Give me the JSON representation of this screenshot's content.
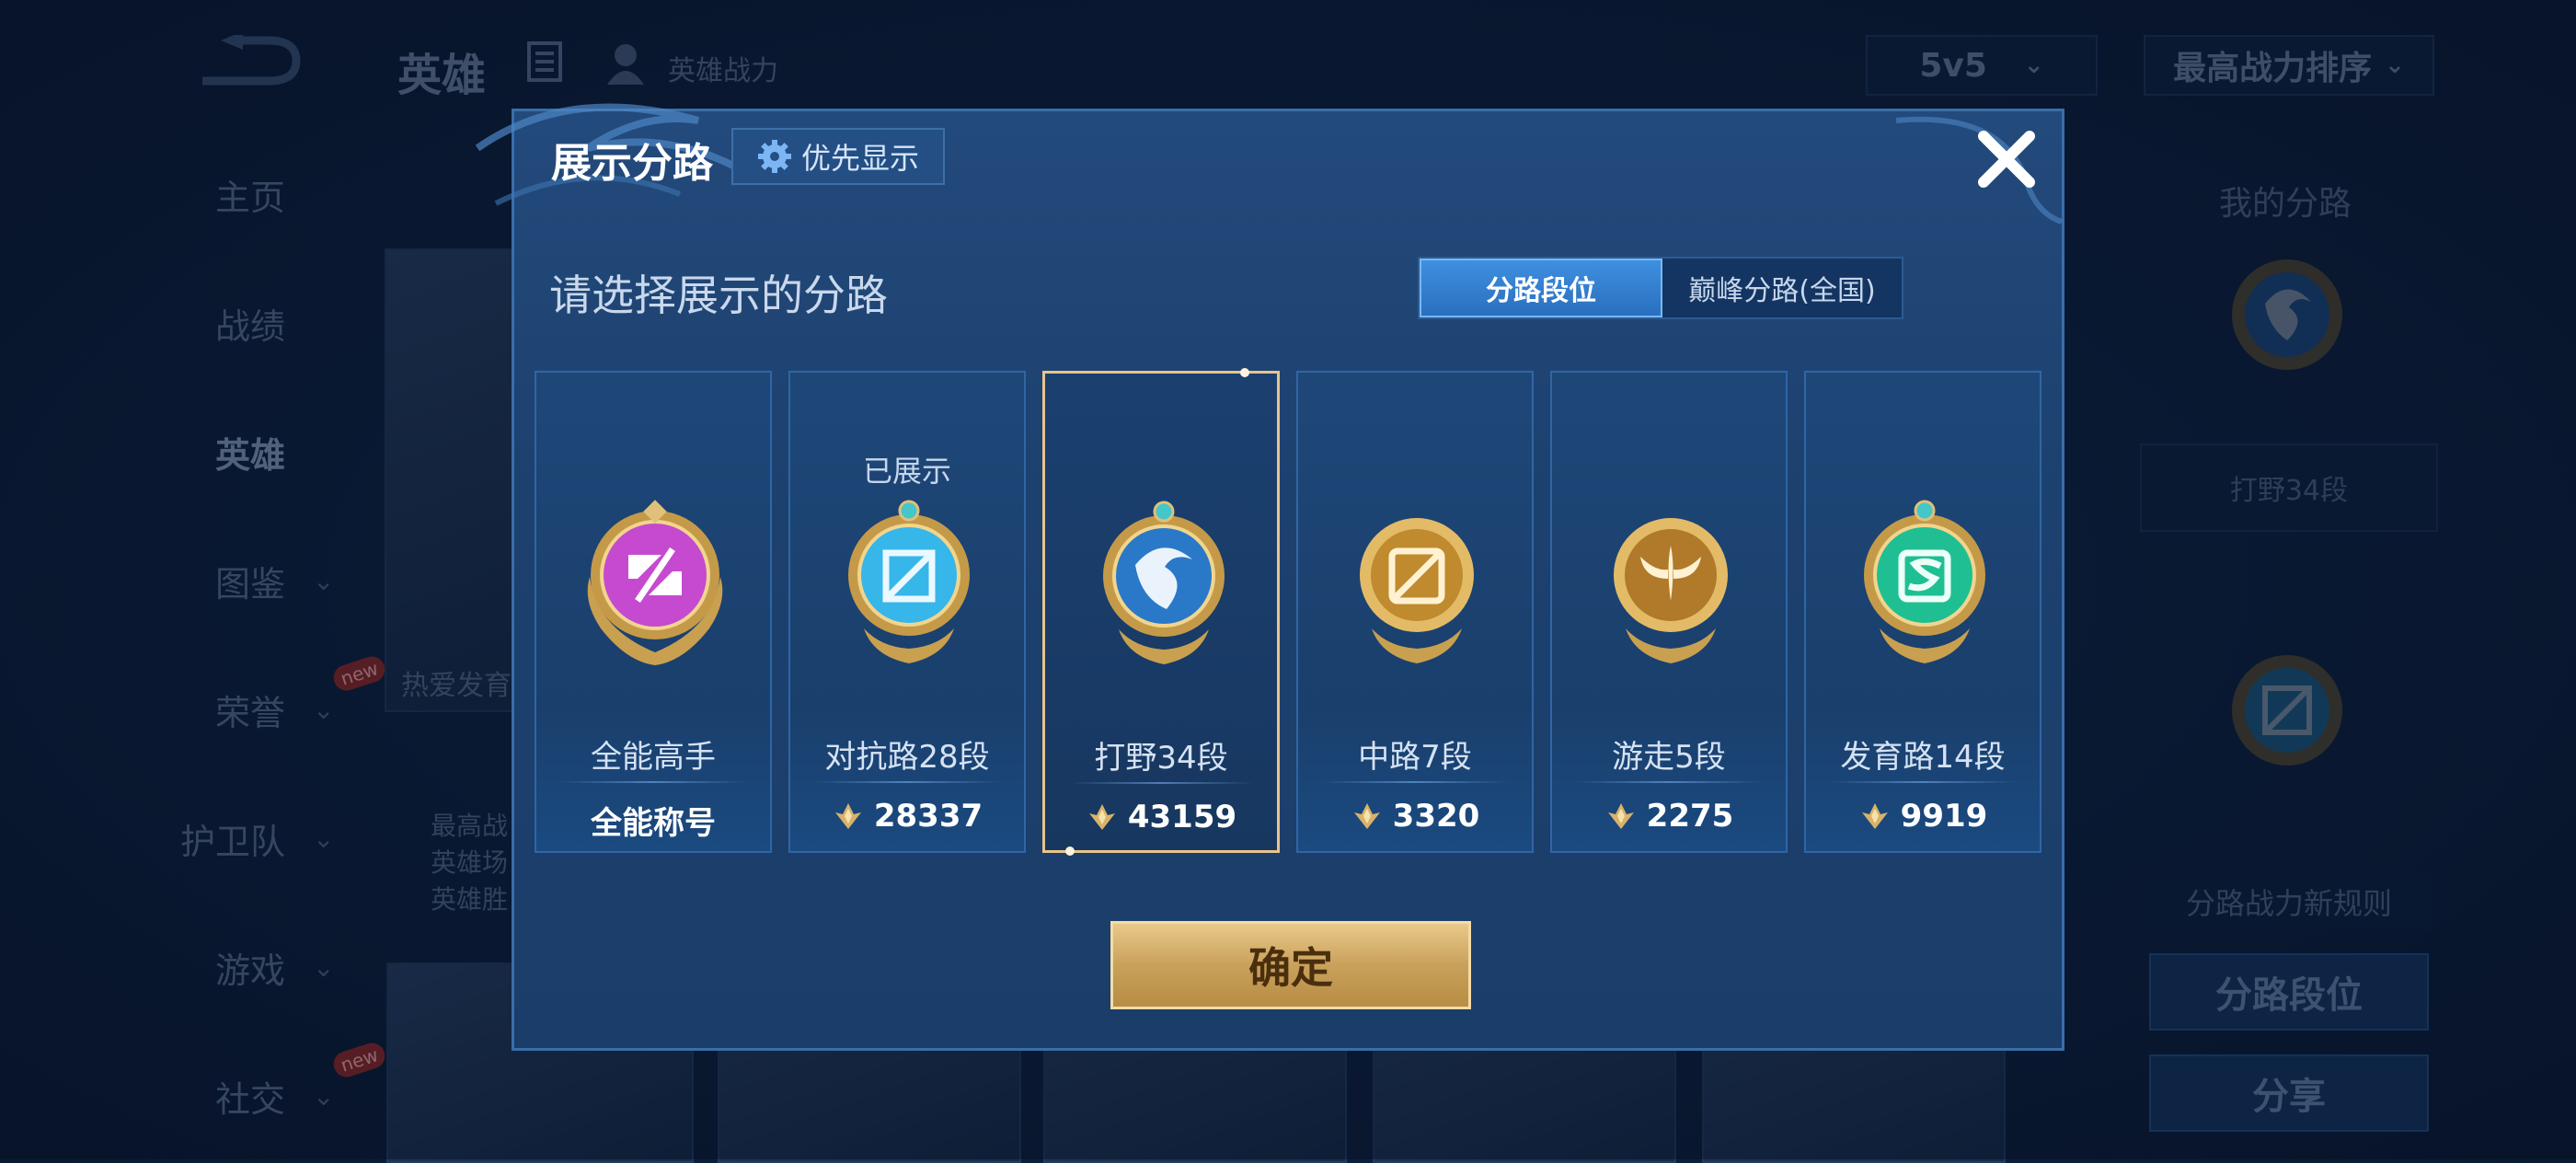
{
  "topbar": {
    "title": "英雄",
    "power_label": "英雄战力",
    "mode": "5v5",
    "sort": "最高战力排序"
  },
  "nav": [
    {
      "label": "主页",
      "chevron": false
    },
    {
      "label": "战绩",
      "chevron": false
    },
    {
      "label": "英雄",
      "chevron": false,
      "active": true
    },
    {
      "label": "图鉴",
      "chevron": true
    },
    {
      "label": "荣誉",
      "chevron": true,
      "badge": "new"
    },
    {
      "label": "护卫队",
      "chevron": true
    },
    {
      "label": "游戏",
      "chevron": true
    },
    {
      "label": "社交",
      "chevron": true,
      "badge": "new"
    }
  ],
  "hero_bg": {
    "card_text": "热爱发育",
    "info_lines": [
      "最高战",
      "英雄场",
      "英雄胜"
    ]
  },
  "side": {
    "title": "我的分路",
    "lane_box": "打野34段",
    "rule": "分路战力新规则",
    "btn_lane": "分路段位",
    "btn_share": "分享"
  },
  "modal": {
    "title": "展示分路",
    "priority_label": "优先显示",
    "subtitle": "请选择展示的分路",
    "tabs": [
      "分路段位",
      "巅峰分路(全国)"
    ],
    "active_tab": 0,
    "confirm": "确定",
    "lanes": [
      {
        "name": "全能高手",
        "value": "全能称号",
        "shown_label": "",
        "selected": false,
        "color": "#c64ad0",
        "icon": "allround-emblem-icon"
      },
      {
        "name": "对抗路28段",
        "value": "28337",
        "shown_label": "已展示",
        "selected": false,
        "color": "#37b6ea",
        "icon": "clash-lane-emblem-icon"
      },
      {
        "name": "打野34段",
        "value": "43159",
        "shown_label": "",
        "selected": true,
        "color": "#2a79c9",
        "icon": "jungle-emblem-icon"
      },
      {
        "name": "中路7段",
        "value": "3320",
        "shown_label": "",
        "selected": false,
        "color": "#c08a2e",
        "icon": "mid-lane-emblem-icon"
      },
      {
        "name": "游走5段",
        "value": "2275",
        "shown_label": "",
        "selected": false,
        "color": "#b07a2a",
        "icon": "roam-emblem-icon"
      },
      {
        "name": "发育路14段",
        "value": "9919",
        "shown_label": "",
        "selected": false,
        "color": "#1fbf93",
        "icon": "farm-lane-emblem-icon"
      }
    ]
  }
}
